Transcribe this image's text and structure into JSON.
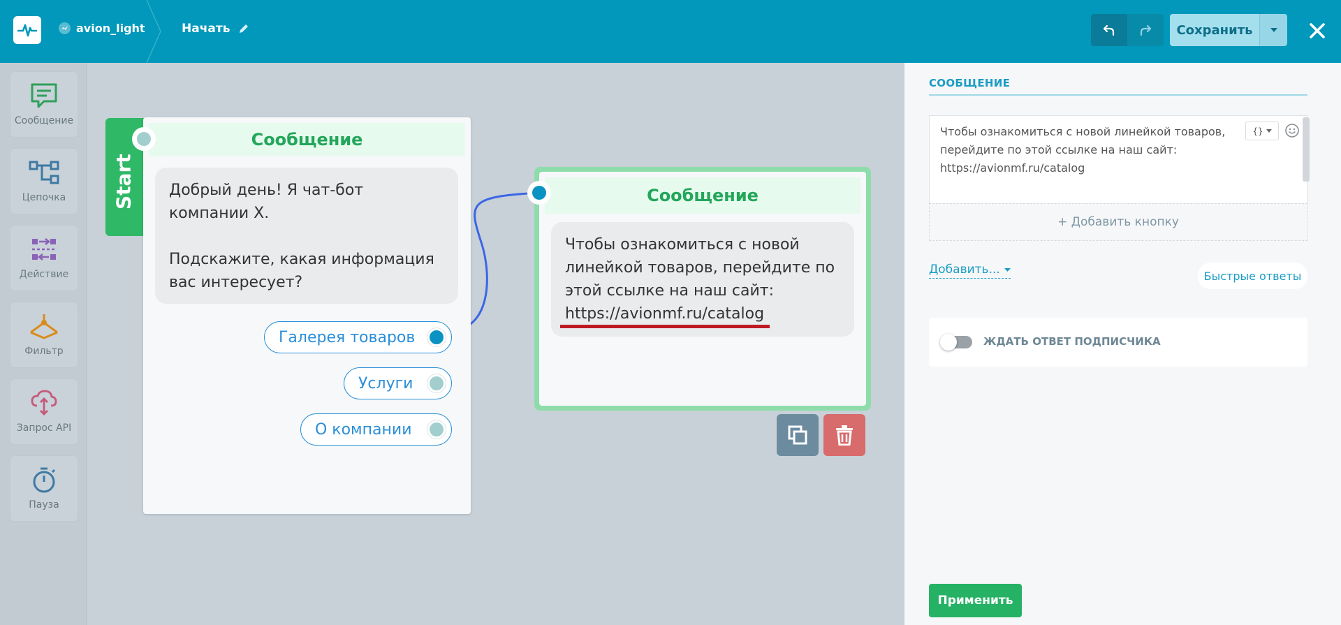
{
  "header": {
    "account_name": "avion_light",
    "flow_name": "Начать",
    "save_label": "Сохранить"
  },
  "toolbar": {
    "items": [
      {
        "label": "Сообщение",
        "icon": "message-icon"
      },
      {
        "label": "Цепочка",
        "icon": "chain-icon"
      },
      {
        "label": "Действие",
        "icon": "action-icon"
      },
      {
        "label": "Фильтр",
        "icon": "filter-icon"
      },
      {
        "label": "Запрос API",
        "icon": "api-request-icon"
      },
      {
        "label": "Пауза",
        "icon": "pause-timer-icon"
      }
    ]
  },
  "canvas": {
    "start_label": "Start",
    "node1": {
      "title": "Сообщение",
      "text": "Добрый день! Я чат-бот компании Х.\n\nПодскажите, какая информация вас интересует?",
      "buttons": [
        "Галерея товаров",
        "Услуги",
        "О компании"
      ]
    },
    "node2": {
      "title": "Сообщение",
      "text": "Чтобы ознакомиться с новой линейкой товаров, перейдите по этой ссылке на наш сайт: https://avionmf.ru/catalog"
    }
  },
  "panel": {
    "title": "СООБЩЕНИЕ",
    "message_text": "Чтобы ознакомиться с новой линейкой товаров, перейдите по этой ссылке на наш сайт: https://avionmf.ru/catalog",
    "var_label": "{}",
    "add_button_label": "+ Добавить кнопку",
    "add_dropdown_label": "Добавить...",
    "quick_replies_label": "Быстрые ответы",
    "wait_label": "ЖДАТЬ ОТВЕТ ПОДПИСЧИКА",
    "apply_label": "Применить"
  },
  "colors": {
    "header_bg": "#0198bb",
    "accent_green": "#26b264",
    "link_blue": "#2a8fd9",
    "underline_red": "#bf1a22"
  }
}
